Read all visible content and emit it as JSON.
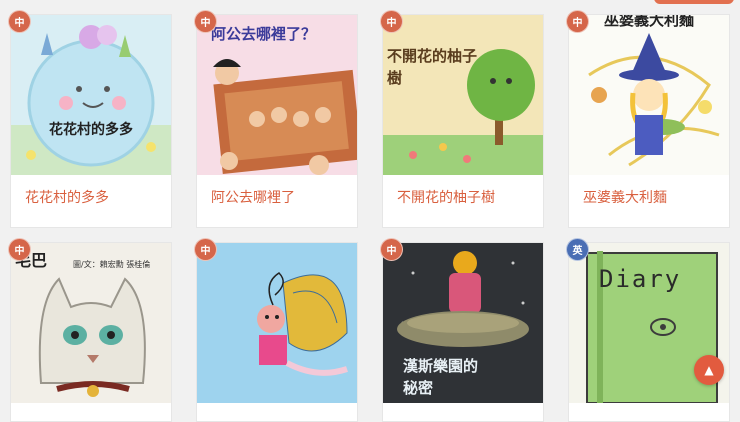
{
  "books": [
    {
      "title": "花花村的多多",
      "lang": "中",
      "cover_text": "花花村的多多"
    },
    {
      "title": "阿公去哪裡了",
      "lang": "中",
      "cover_text": "阿公去哪裡了？"
    },
    {
      "title": "不開花的柚子樹",
      "lang": "中",
      "cover_text": "不開花的柚子樹"
    },
    {
      "title": "巫婆義大利麵",
      "lang": "中",
      "cover_text": "巫婆義大利麵"
    },
    {
      "title": "",
      "lang": "中",
      "cover_text": "毛巴",
      "cover_sub": "圖/文：賴宏勳 張桂倫"
    },
    {
      "title": "",
      "lang": "中",
      "cover_text": ""
    },
    {
      "title": "",
      "lang": "中",
      "cover_text": "漢斯樂園的秘密"
    },
    {
      "title": "",
      "lang": "英",
      "cover_text": "Diary"
    }
  ],
  "colors": {
    "accent": "#d9603f",
    "badge_zh": "#d5664a",
    "badge_en": "#4a6eb4"
  },
  "icons": {
    "scroll_top": "arrow-up-icon"
  },
  "scroll_top_glyph": "▲"
}
